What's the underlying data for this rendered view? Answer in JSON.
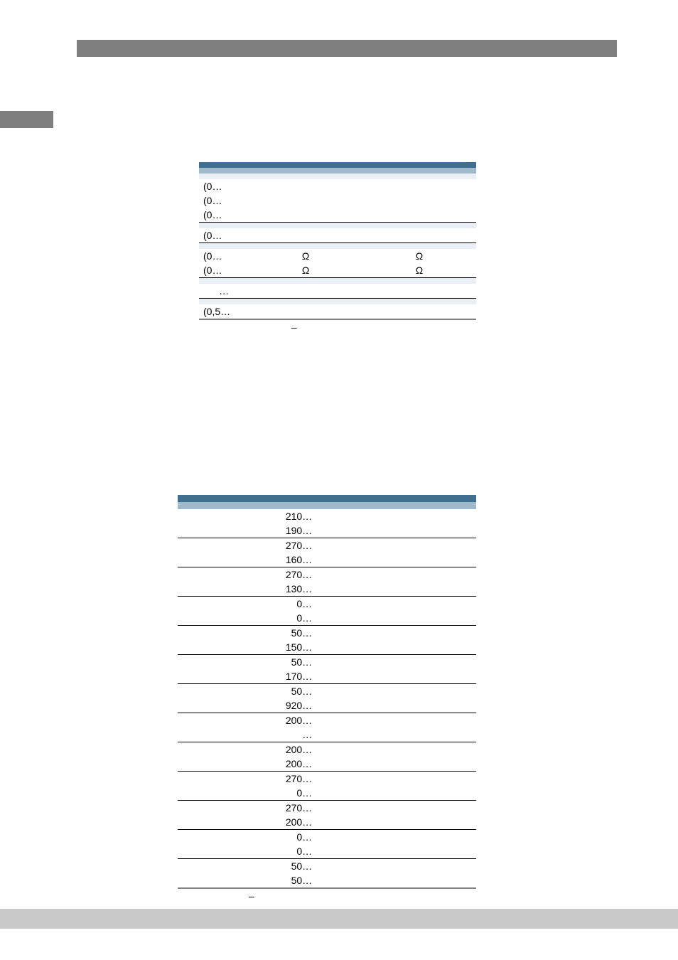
{
  "table1": {
    "rows": [
      {
        "c1": "(0…",
        "c2": "",
        "c3": ""
      },
      {
        "c1": "(0…",
        "c2": "",
        "c3": ""
      },
      {
        "c1": "(0…",
        "c2": "",
        "c3": ""
      }
    ],
    "row_single": {
      "c1": "(0…",
      "c2": "",
      "c3": ""
    },
    "ohm_rows": [
      {
        "c1": "(0…",
        "c2": "Ω",
        "c3": "Ω"
      },
      {
        "c1": "(0…",
        "c2": "Ω",
        "c3": "Ω"
      }
    ],
    "ellipsis": {
      "c1": "…",
      "c2": "",
      "c3": ""
    },
    "last": {
      "c1": "(0,5…",
      "c2": "",
      "c3": ""
    },
    "dash": "–"
  },
  "table2": {
    "vals": [
      "210…",
      "190…",
      "270…",
      "160…",
      "270…",
      "130…",
      "0…",
      "0…",
      "50…",
      "150…",
      "50…",
      "170…",
      "50…",
      "920…",
      "200…",
      "…",
      "200…",
      "200…",
      "270…",
      "0…",
      "270…",
      "200…",
      "0…",
      "0…",
      "50…",
      "50…"
    ],
    "dash": "–"
  }
}
